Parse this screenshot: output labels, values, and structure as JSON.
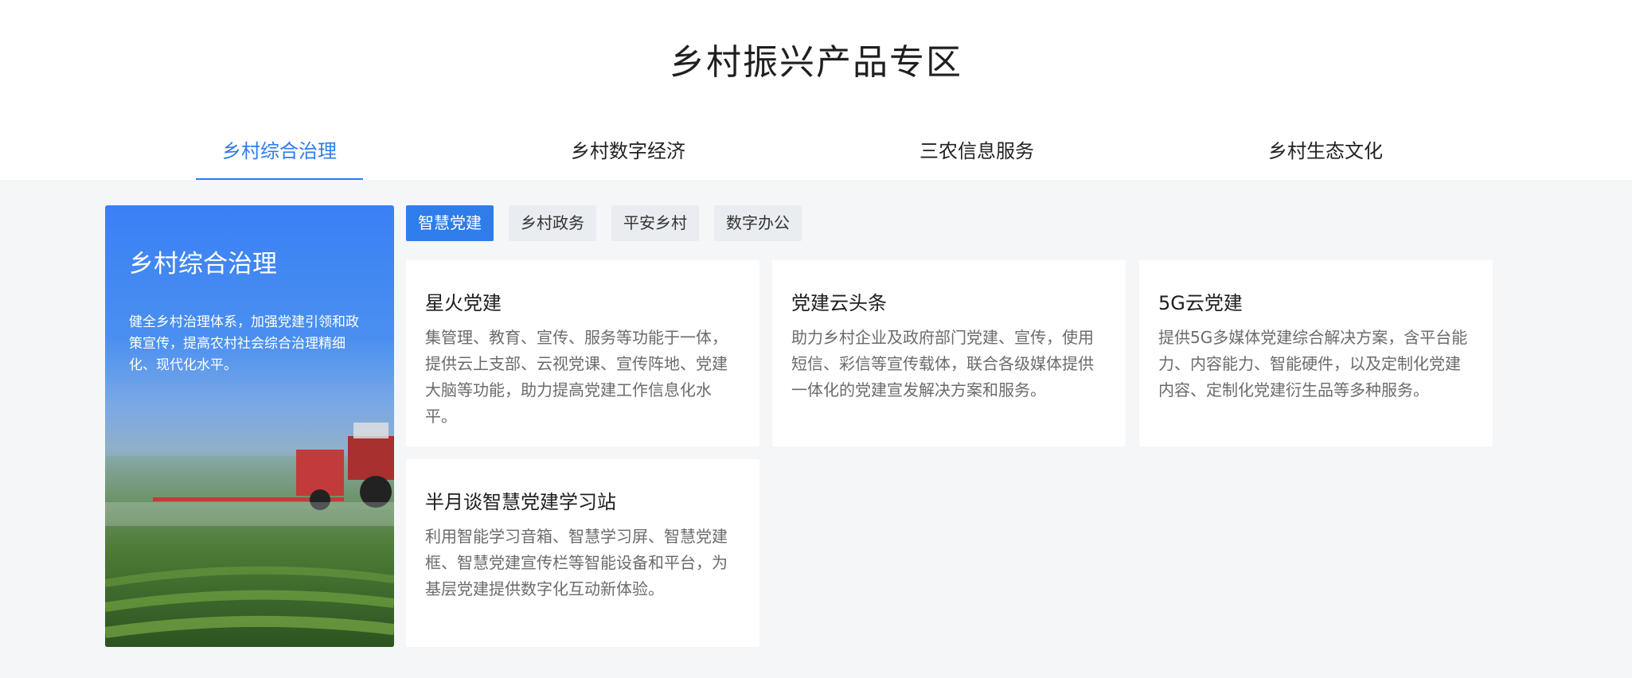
{
  "page_title": "乡村振兴产品专区",
  "main_tabs": [
    {
      "label": "乡村综合治理",
      "active": true
    },
    {
      "label": "乡村数字经济",
      "active": false
    },
    {
      "label": "三农信息服务",
      "active": false
    },
    {
      "label": "乡村生态文化",
      "active": false
    }
  ],
  "hero": {
    "title": "乡村综合治理",
    "description": "健全乡村治理体系，加强党建引领和政策宣传，提高农村社会综合治理精细化、现代化水平。",
    "image_icon": "tractor-field-image"
  },
  "sub_tabs": [
    {
      "label": "智慧党建",
      "active": true
    },
    {
      "label": "乡村政务",
      "active": false
    },
    {
      "label": "平安乡村",
      "active": false
    },
    {
      "label": "数字办公",
      "active": false
    }
  ],
  "cards": [
    {
      "title": "星火党建",
      "description": "集管理、教育、宣传、服务等功能于一体，提供云上支部、云视党课、宣传阵地、党建大脑等功能，助力提高党建工作信息化水平。"
    },
    {
      "title": "党建云头条",
      "description": "助力乡村企业及政府部门党建、宣传，使用短信、彩信等宣传载体，联合各级媒体提供一体化的党建宣发解决方案和服务。"
    },
    {
      "title": "5G云党建",
      "description": "提供5G多媒体党建综合解决方案，含平台能力、内容能力、智能硬件，以及定制化党建内容、定制化党建衍生品等多种服务。"
    },
    {
      "title": "半月谈智慧党建学习站",
      "description": "利用智能学习音箱、智慧学习屏、智慧党建框、智慧党建宣传栏等智能设备和平台，为基层党建提供数字化互动新体验。"
    }
  ],
  "colors": {
    "accent": "#2f7dea",
    "background_gray": "#f4f6f8"
  }
}
